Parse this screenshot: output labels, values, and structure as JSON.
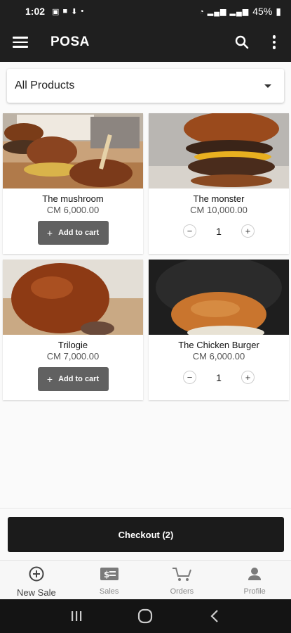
{
  "status_bar": {
    "time": "1:02",
    "battery": "45%"
  },
  "app_bar": {
    "title": "POSA"
  },
  "filter": {
    "selected": "All Products"
  },
  "products": [
    {
      "name": "The mushroom",
      "price": "CM 6,000.00",
      "in_cart": false,
      "add_label": "Add to cart"
    },
    {
      "name": "The monster",
      "price": "CM 10,000.00",
      "in_cart": true,
      "quantity": "1"
    },
    {
      "name": "Trilogie",
      "price": "CM 7,000.00",
      "in_cart": false,
      "add_label": "Add to cart"
    },
    {
      "name": "The Chicken Burger",
      "price": "CM 6,000.00",
      "in_cart": true,
      "quantity": "1"
    }
  ],
  "checkout": {
    "label": "Checkout (2)"
  },
  "bottom_nav": [
    {
      "label": "New Sale",
      "icon": "add-circle-icon",
      "active": true
    },
    {
      "label": "Sales",
      "icon": "cash-icon",
      "active": false
    },
    {
      "label": "Orders",
      "icon": "cart-icon",
      "active": false
    },
    {
      "label": "Profile",
      "icon": "person-icon",
      "active": false
    }
  ],
  "colors": {
    "app_bar": "#1f1f1f",
    "add_button": "#616161",
    "checkout": "#1b1b1b"
  }
}
